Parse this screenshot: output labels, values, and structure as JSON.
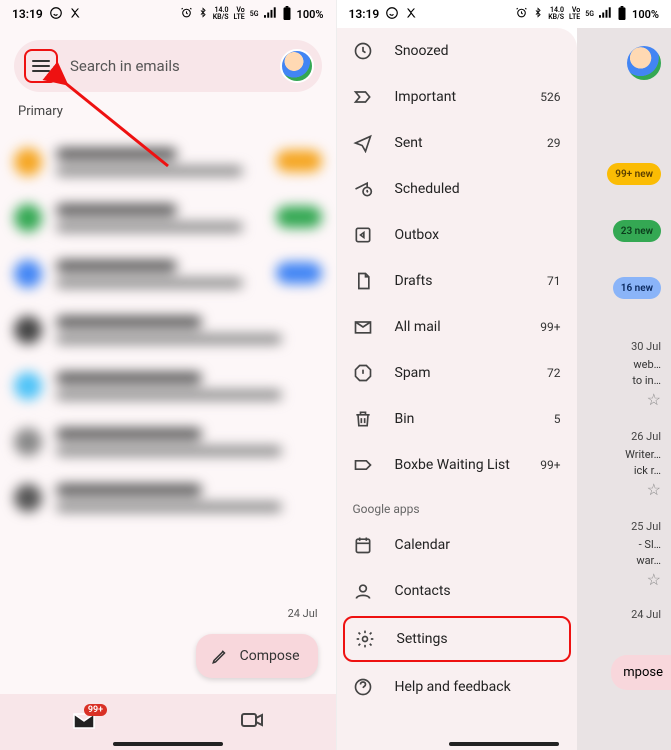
{
  "status": {
    "time": "13:19",
    "net1_top": "14.0",
    "net1_bot": "KB/S",
    "net2_top": "Vo",
    "net2_bot": "LTE",
    "net3": "5G",
    "battery": "100%"
  },
  "left": {
    "search_placeholder": "Search in emails",
    "section": "Primary",
    "compose": "Compose",
    "mail_badge": "99+",
    "date_visible": "24 Jul"
  },
  "drawer": {
    "items": [
      {
        "icon": "snooze",
        "label": "Snoozed",
        "count": ""
      },
      {
        "icon": "important",
        "label": "Important",
        "count": "526"
      },
      {
        "icon": "sent",
        "label": "Sent",
        "count": "29"
      },
      {
        "icon": "scheduled",
        "label": "Scheduled",
        "count": ""
      },
      {
        "icon": "outbox",
        "label": "Outbox",
        "count": ""
      },
      {
        "icon": "drafts",
        "label": "Drafts",
        "count": "71"
      },
      {
        "icon": "allmail",
        "label": "All mail",
        "count": "99+"
      },
      {
        "icon": "spam",
        "label": "Spam",
        "count": "72"
      },
      {
        "icon": "bin",
        "label": "Bin",
        "count": "5"
      },
      {
        "icon": "label",
        "label": "Boxbe Waiting List",
        "count": "99+"
      }
    ],
    "section2": "Google apps",
    "apps": [
      {
        "icon": "calendar",
        "label": "Calendar"
      },
      {
        "icon": "contacts",
        "label": "Contacts"
      }
    ],
    "settings": "Settings",
    "help": "Help and feedback"
  },
  "backdrop": {
    "pill1": "99+ new",
    "pill2": "23 new",
    "pill3": "16 new",
    "d1": "30 Jul",
    "l1a": "web…",
    "l1b": "to in…",
    "d2": "26 Jul",
    "l2a": "Writer…",
    "l2b": "ick r…",
    "d3": "25 Jul",
    "l3a": "- Sl…",
    "l3b": "war…",
    "d4": "24 Jul",
    "compose_peek": "mpose"
  }
}
